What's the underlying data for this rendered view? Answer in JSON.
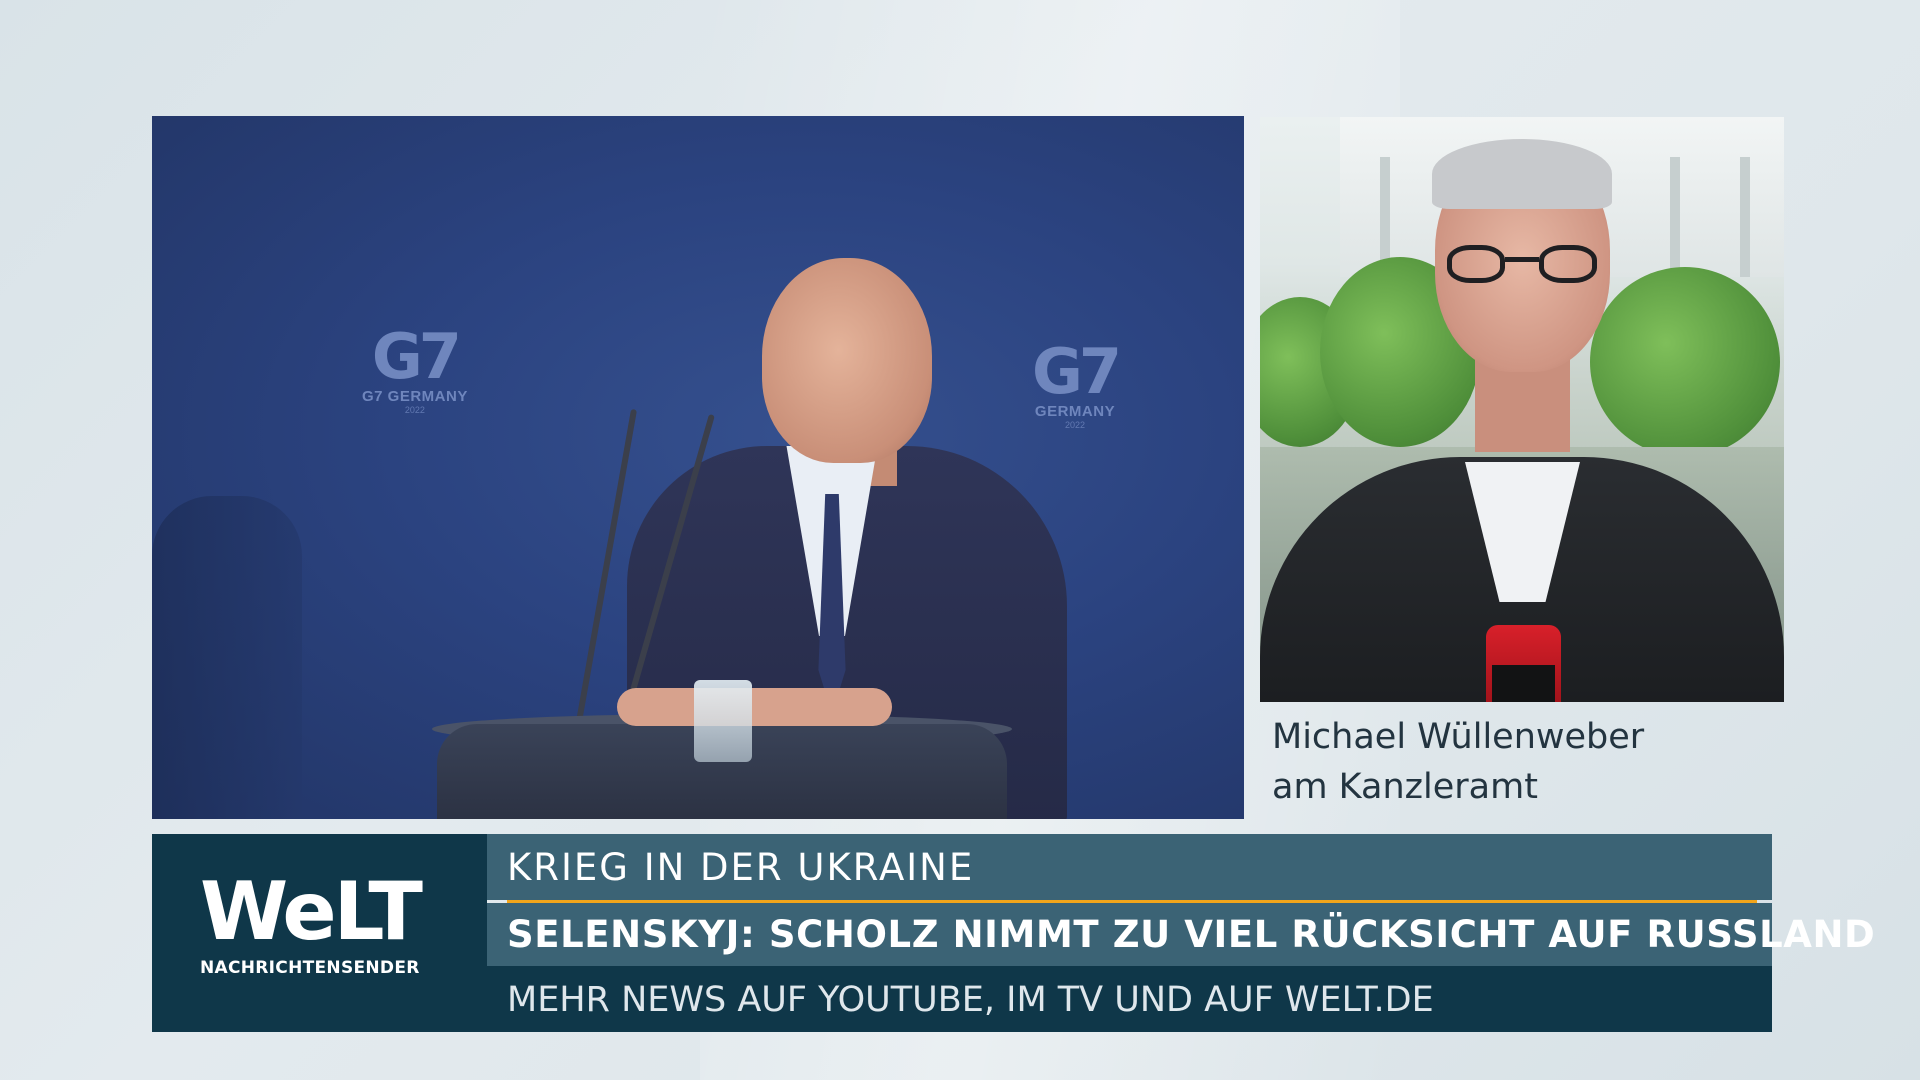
{
  "main_video": {
    "logos": [
      {
        "mark": "G7",
        "sub": "G7 GERMANY",
        "year": "2022"
      },
      {
        "mark": "G7",
        "sub": "GERMANY",
        "year": "2022"
      }
    ]
  },
  "side_video": {
    "caption_line1": "Michael Wüllenweber",
    "caption_line2": "am Kanzleramt"
  },
  "lower_third": {
    "logo_word": "WeLT",
    "logo_sub": "NACHRICHTENSENDER",
    "topline": "KRIEG IN DER UKRAINE",
    "headline": "SELENSKYJ: SCHOLZ NIMMT ZU VIEL RÜCKSICHT AUF RUSSLAND",
    "ticker": "MEHR NEWS AUF YOUTUBE, IM TV UND AUF WELT.DE"
  },
  "colors": {
    "brand_dark": "#0f3749",
    "bar_blue": "#3b6375",
    "accent": "#f2a51a",
    "backdrop": "#2b4380"
  }
}
